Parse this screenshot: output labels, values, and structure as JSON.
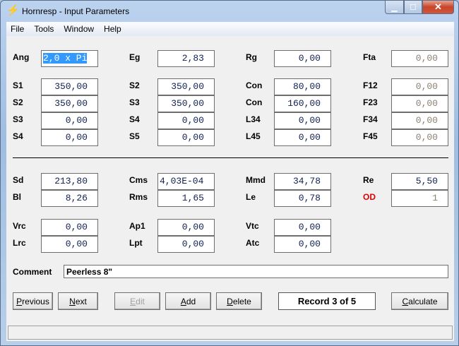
{
  "window": {
    "title": "Hornresp - Input Parameters"
  },
  "menu": [
    "File",
    "Tools",
    "Window",
    "Help"
  ],
  "row0": [
    {
      "label": "Ang",
      "value": "2,0 x Pi"
    },
    {
      "label": "Eg",
      "value": "2,83"
    },
    {
      "label": "Rg",
      "value": "0,00"
    },
    {
      "label": "Fta",
      "value": "0,00"
    }
  ],
  "rows1": [
    [
      {
        "label": "S1",
        "value": "350,00"
      },
      {
        "label": "S2",
        "value": "350,00"
      },
      {
        "label": "Con",
        "value": "80,00"
      },
      {
        "label": "F12",
        "value": "0,00"
      }
    ],
    [
      {
        "label": "S2",
        "value": "350,00"
      },
      {
        "label": "S3",
        "value": "350,00"
      },
      {
        "label": "Con",
        "value": "160,00"
      },
      {
        "label": "F23",
        "value": "0,00"
      }
    ],
    [
      {
        "label": "S3",
        "value": "0,00"
      },
      {
        "label": "S4",
        "value": "0,00"
      },
      {
        "label": "L34",
        "value": "0,00"
      },
      {
        "label": "F34",
        "value": "0,00"
      }
    ],
    [
      {
        "label": "S4",
        "value": "0,00"
      },
      {
        "label": "S5",
        "value": "0,00"
      },
      {
        "label": "L45",
        "value": "0,00"
      },
      {
        "label": "F45",
        "value": "0,00"
      }
    ]
  ],
  "rows2": [
    [
      {
        "label": "Sd",
        "value": "213,80"
      },
      {
        "label": "Cms",
        "value": "4,03E-04"
      },
      {
        "label": "Mmd",
        "value": "34,78"
      },
      {
        "label": "Re",
        "value": "5,50"
      }
    ],
    [
      {
        "label": "Bl",
        "value": "8,26"
      },
      {
        "label": "Rms",
        "value": "1,65"
      },
      {
        "label": "Le",
        "value": "0,78"
      },
      {
        "label": "OD",
        "value": "1"
      }
    ]
  ],
  "rows3": [
    [
      {
        "label": "Vrc",
        "value": "0,00"
      },
      {
        "label": "Ap1",
        "value": "0,00"
      },
      {
        "label": "Vtc",
        "value": "0,00"
      }
    ],
    [
      {
        "label": "Lrc",
        "value": "0,00"
      },
      {
        "label": "Lpt",
        "value": "0,00"
      },
      {
        "label": "Atc",
        "value": "0,00"
      }
    ]
  ],
  "comment": {
    "label": "Comment",
    "value": "Peerless 8\""
  },
  "buttons": {
    "previous": "Previous",
    "next": "Next",
    "edit": "Edit",
    "add": "Add",
    "delete": "Delete",
    "calculate": "Calculate"
  },
  "record": "Record 3 of 5"
}
